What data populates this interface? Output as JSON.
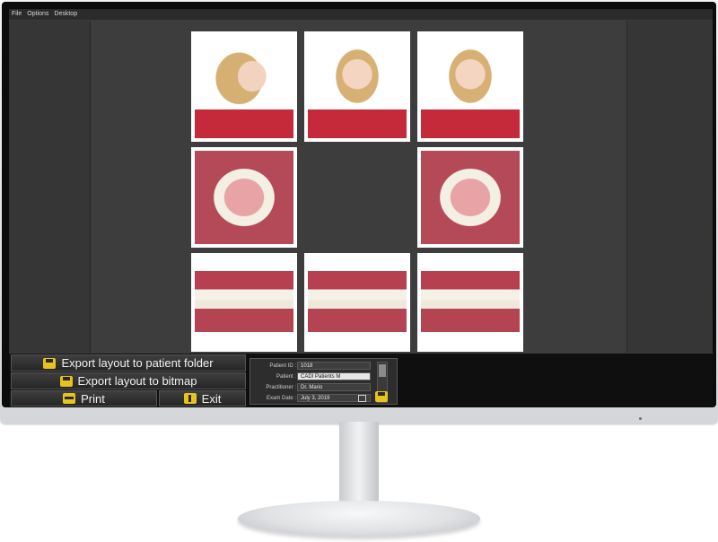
{
  "menu": {
    "items": [
      "File",
      "Options",
      "Desktop"
    ]
  },
  "photos": [
    {
      "kind": "profile-right",
      "label": ""
    },
    {
      "kind": "frontal",
      "label": ""
    },
    {
      "kind": "frontal-smile",
      "label": ""
    },
    {
      "kind": "upper-occlusal",
      "label": ""
    },
    {
      "kind": "empty",
      "label": ""
    },
    {
      "kind": "lower-occlusal",
      "label": ""
    },
    {
      "kind": "right-buccal",
      "label": ""
    },
    {
      "kind": "frontal-intraoral",
      "label": ""
    },
    {
      "kind": "left-buccal",
      "label": ""
    }
  ],
  "actions": {
    "export_patient": "Export layout to patient folder",
    "export_bitmap": "Export layout to bitmap",
    "print": "Print",
    "exit": "Exit"
  },
  "patient": {
    "id_label": "Patient ID :",
    "id_value": "1018",
    "patient_label": "Patient :",
    "patient_value": "CADI Patients M",
    "practitioner_label": "Practitioner :",
    "practitioner_value": "Dr. Mario",
    "exam_label": "Exam Date :",
    "exam_value": "July       3, 2019"
  },
  "icons": {
    "save": "floppy-disk-icon",
    "print": "printer-icon",
    "exit": "exit-door-icon",
    "calendar": "calendar-icon"
  },
  "colors": {
    "accent": "#e7c31d",
    "screen_bg": "#3c3c3c"
  }
}
